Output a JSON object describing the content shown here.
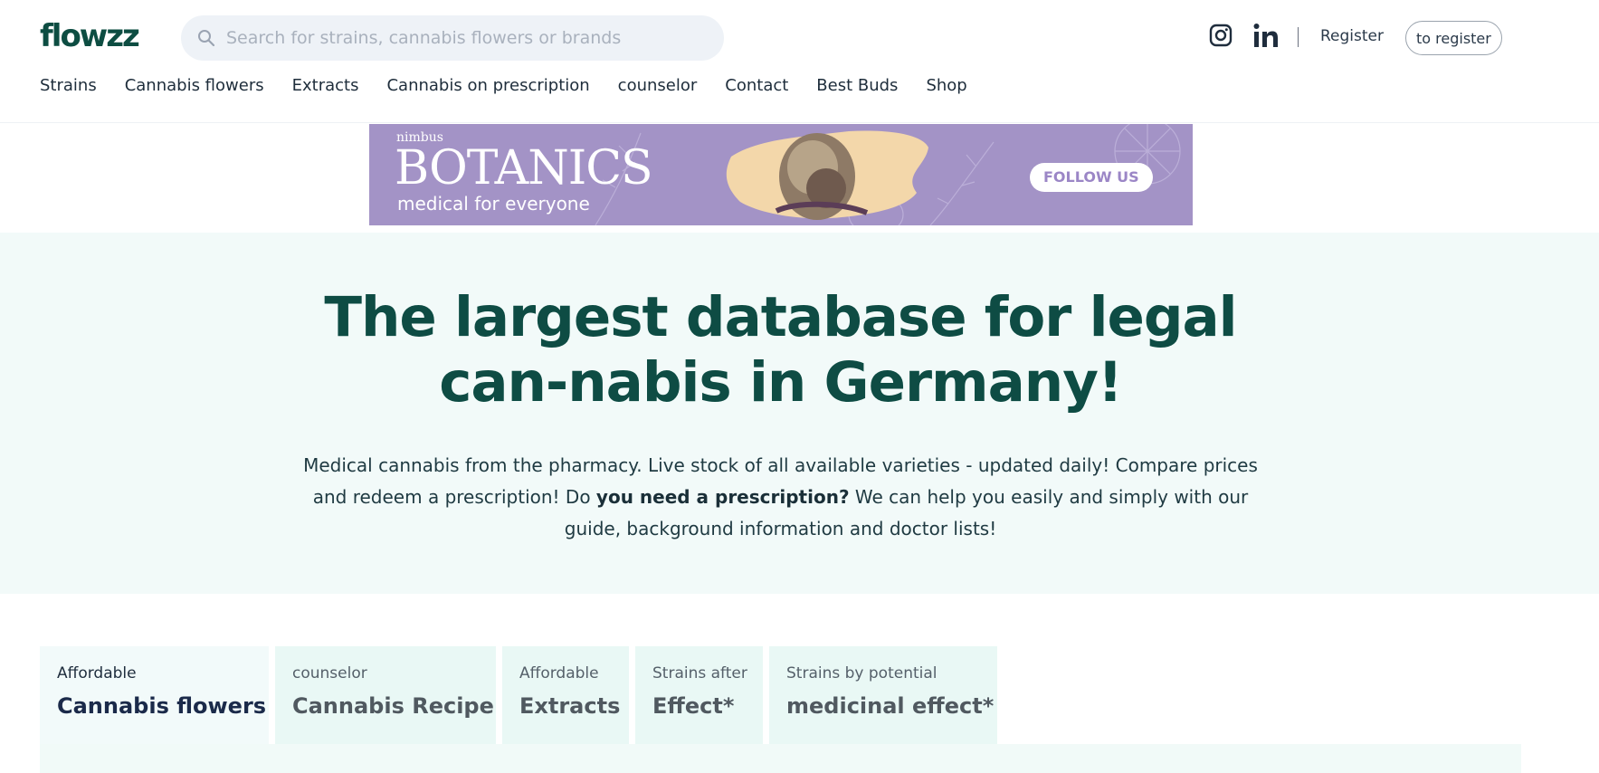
{
  "header": {
    "logo": "flowzz",
    "search_placeholder": "Search for strains, cannabis flowers or brands",
    "icons": [
      "search-icon",
      "instagram-icon",
      "linkedin-icon"
    ],
    "register_label": "Register",
    "to_register_label": "to register"
  },
  "nav": {
    "items": [
      {
        "label": "Strains"
      },
      {
        "label": "Cannabis flowers"
      },
      {
        "label": "Extracts"
      },
      {
        "label": "Cannabis on prescription"
      },
      {
        "label": "counselor"
      },
      {
        "label": "Contact"
      },
      {
        "label": "Best Buds"
      },
      {
        "label": "Shop"
      }
    ]
  },
  "banner": {
    "brand_small": "nimbus",
    "brand_big": "BOTANICS",
    "tagline": "medical for everyone",
    "cta": "FOLLOW US",
    "background_color": "#a393c6"
  },
  "hero": {
    "title": "The largest database for legal can-nabis in Germany!",
    "text_part1": "Medical cannabis from the pharmacy. Live stock of all available varieties - updated daily! Compare prices and redeem a prescription! Do ",
    "text_bold": "you need a prescription?",
    "text_part2": " We can help you easily and simply with our guide, background information and doctor lists!",
    "title_color": "#0e4c44",
    "background_color": "#f2faf9"
  },
  "tabs": [
    {
      "small": "Affordable",
      "big": "Cannabis flowers",
      "active": true
    },
    {
      "small": "counselor",
      "big": "Cannabis Recipe",
      "active": false
    },
    {
      "small": "Affordable",
      "big": "Extracts",
      "active": false
    },
    {
      "small": "Strains after",
      "big": "Effect*",
      "active": false
    },
    {
      "small": "Strains by potential",
      "big": "medicinal effect*",
      "active": false
    }
  ]
}
